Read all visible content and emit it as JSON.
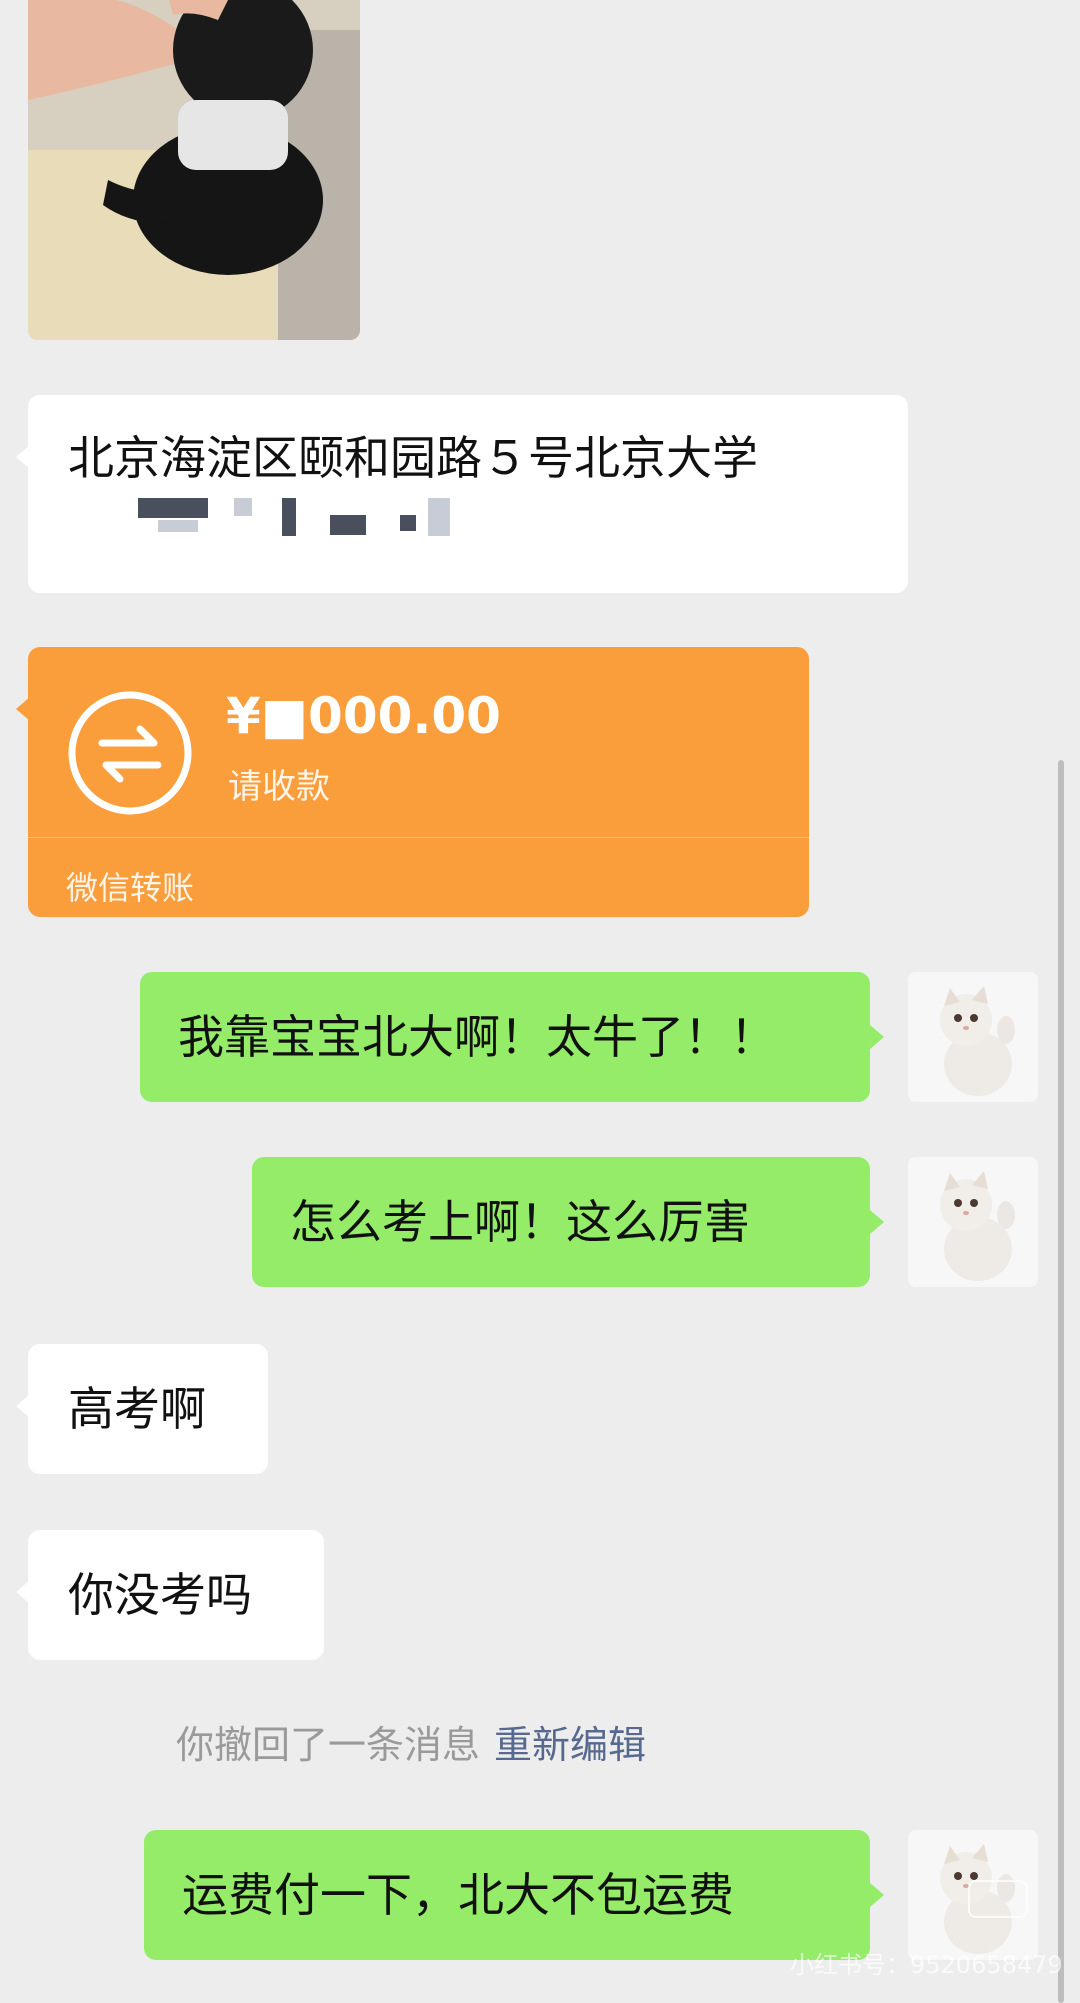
{
  "messages": {
    "address": "北京海淀区颐和园路５号北京大学",
    "transfer": {
      "amount": "¥■000.00",
      "status": "请收款",
      "label": "微信转账"
    },
    "out1": "我靠宝宝北大啊！太牛了！！",
    "out2": "怎么考上啊！这么厉害",
    "in1": "高考啊",
    "in2": "你没考吗",
    "recall": {
      "text": "你撤回了一条消息",
      "action": "重新编辑"
    },
    "out3": "运费付一下，北大不包运费"
  },
  "watermark": {
    "text": "小红书号：9520658479"
  },
  "colors": {
    "background": "#ededed",
    "incoming_bubble": "#ffffff",
    "outgoing_bubble": "#95ec69",
    "transfer_card": "#fa9d3b",
    "link": "#57698f"
  },
  "icons": {
    "transfer": "transfer-arrows-icon",
    "avatar": "white-cat-avatar"
  }
}
